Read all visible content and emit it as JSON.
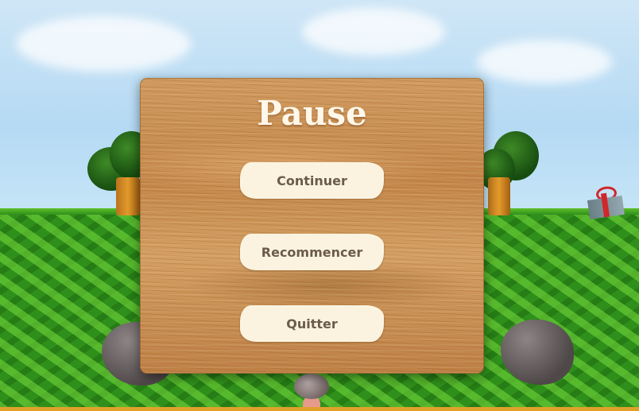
{
  "pause_menu": {
    "title": "Pause",
    "buttons": {
      "continue": "Continuer",
      "restart": "Recommencer",
      "quit": "Quitter"
    }
  },
  "colors": {
    "panel_wood": "#c98f52",
    "button_fill": "#fbf3e0",
    "button_text": "#6b5b49",
    "title_text": "#fff8ea",
    "grass": "#2f8f1b",
    "sky": "#b5daf4"
  },
  "icons": [
    "gift-box-icon"
  ]
}
